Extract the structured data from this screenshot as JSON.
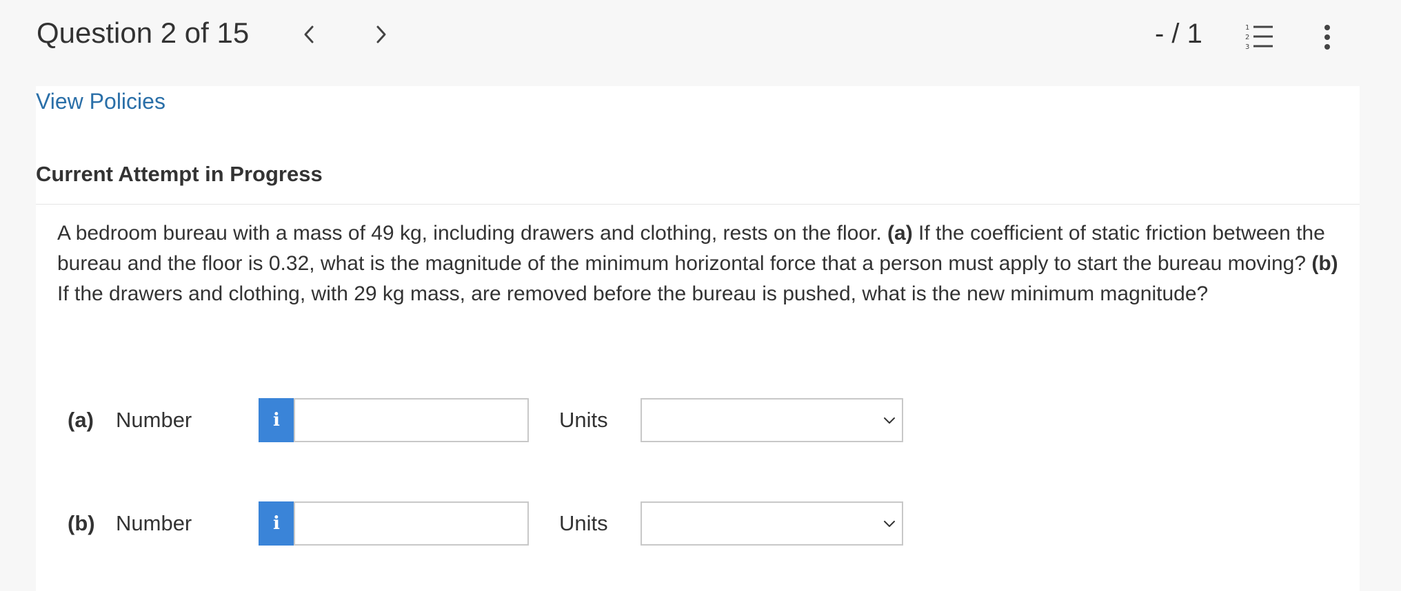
{
  "header": {
    "question_title": "Question 2 of 15",
    "prev_icon": "chevron-left-icon",
    "next_icon": "chevron-right-icon",
    "score": "- / 1",
    "list_icon": "numbered-list-icon",
    "more_icon": "more-vertical-icon"
  },
  "content": {
    "policies_link": "View Policies",
    "attempt_heading": "Current Attempt in Progress",
    "question": {
      "intro": "A bedroom bureau with a mass of 49 kg, including drawers and clothing, rests on the floor. ",
      "part_a_tag": "(a)",
      "part_a_text": " If the coefficient of static friction between the bureau and the floor is 0.32, what is the magnitude of the minimum horizontal force that a person must apply to start the bureau moving? ",
      "part_b_tag": "(b)",
      "part_b_text": " If the drawers and clothing, with 29 kg mass, are removed before the bureau is pushed, what is the new minimum magnitude?"
    },
    "answers": [
      {
        "part": "(a)",
        "number_label": "Number",
        "info_icon": "i",
        "value": "",
        "units_label": "Units",
        "units_value": ""
      },
      {
        "part": "(b)",
        "number_label": "Number",
        "info_icon": "i",
        "value": "",
        "units_label": "Units",
        "units_value": ""
      }
    ]
  },
  "colors": {
    "link": "#2a6fa8",
    "info_button": "#3a84d8",
    "background": "#f7f7f7",
    "panel": "#ffffff"
  }
}
